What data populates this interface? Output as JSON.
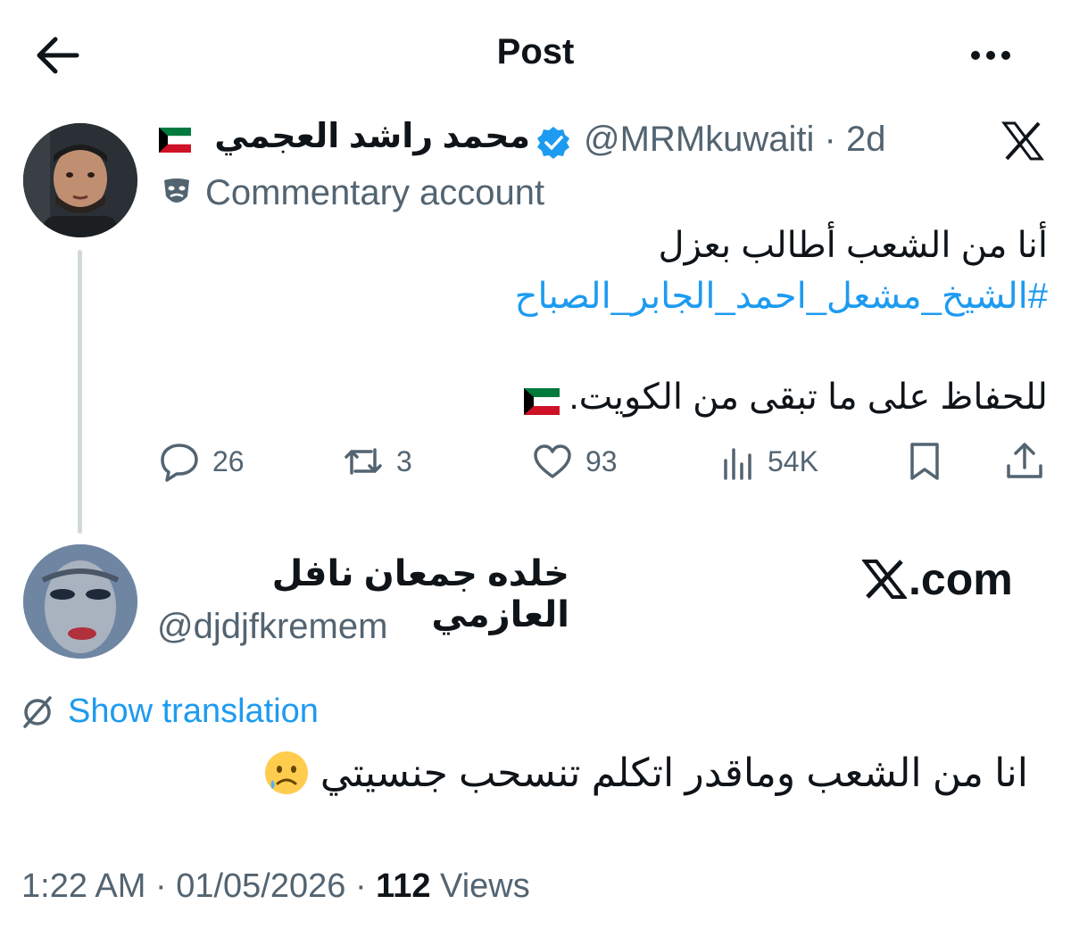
{
  "header": {
    "title": "Post"
  },
  "post": {
    "author_name": "محمد راشد العجمي",
    "handle": "@MRMkuwaiti",
    "separator": " · ",
    "age": "2d",
    "label": "Commentary account",
    "line1": "أنا من الشعب أطالب بعزل",
    "hashtag": "#الشيخ_مشعل_احمد_الجابر_الصباح",
    "line3": "للحفاظ على ما تبقى من الكويت.",
    "actions": {
      "replies": "26",
      "reposts": "3",
      "likes": "93",
      "views": "54K"
    }
  },
  "reply": {
    "author_name": "خلده جمعان نافل العازمي",
    "handle": "@djdjfkremem",
    "watermark": ".com",
    "show_translation": "Show translation",
    "text": "انا من الشعب وماقدر اتكلم تنسحب جنسيتي"
  },
  "meta": {
    "time": "1:22 AM",
    "dot": " · ",
    "date": "01/05/2026",
    "views_count": "112",
    "views_label": " Views"
  },
  "colors": {
    "accent": "#1d9bf0",
    "muted": "#536471",
    "text": "#0f1419"
  },
  "icons": [
    "back-arrow-icon",
    "more-icon",
    "verified-badge-icon",
    "x-logo-icon",
    "commentary-mask-icon",
    "reply-icon",
    "repost-icon",
    "like-icon",
    "views-icon",
    "bookmark-icon",
    "share-icon",
    "translate-icon",
    "kuwait-flag-icon",
    "sad-face-emoji"
  ]
}
